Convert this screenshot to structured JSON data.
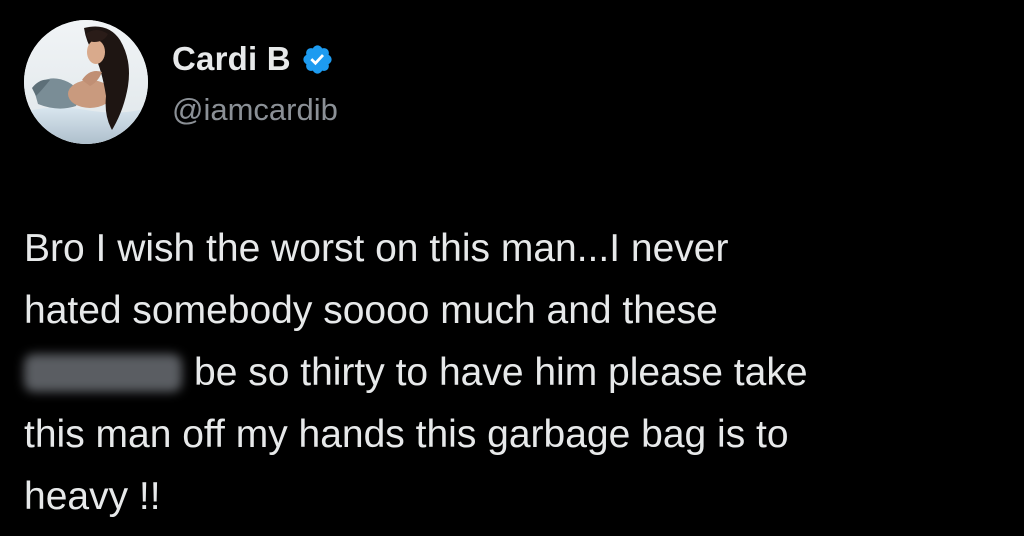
{
  "author": {
    "display_name": "Cardi B",
    "handle": "@iamcardib",
    "verified": true,
    "verified_icon": "verified-badge-icon",
    "avatar": "profile-photo"
  },
  "tweet": {
    "lines": [
      "Bro I wish the worst on this man...I never",
      "hated somebody soooo much and these",
      "be so thirty to have him please take",
      "this man off my hands this garbage bag  is to",
      "heavy !!"
    ],
    "redacted_word": true
  },
  "colors": {
    "background": "#000000",
    "text": "#e7e9ea",
    "secondary_text": "#8b9096",
    "verified_blue": "#1d9bf0"
  }
}
